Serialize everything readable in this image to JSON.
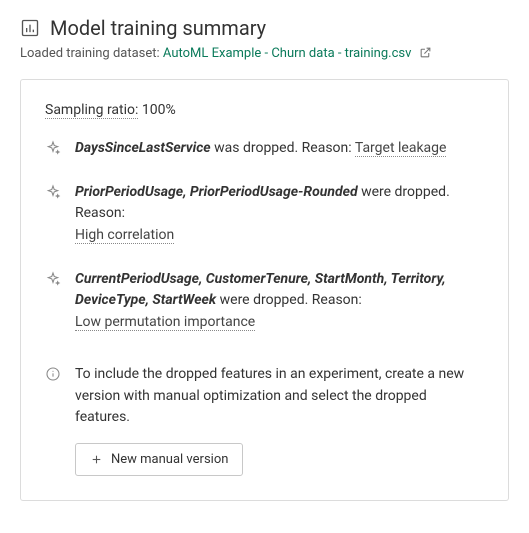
{
  "header": {
    "title": "Model training summary",
    "loaded_label": "Loaded training dataset:",
    "dataset_name": "AutoML Example - Churn data - training.csv"
  },
  "sampling": {
    "label": "Sampling ratio:",
    "value": "100%"
  },
  "drops": [
    {
      "features": "DaysSinceLastService",
      "verb": "was dropped. Reason:",
      "reason": "Target leakage",
      "reason_inline": true
    },
    {
      "features": "PriorPeriodUsage, PriorPeriodUsage-Rounded",
      "verb": "were dropped. Reason:",
      "reason": "High correlation",
      "reason_inline": false
    },
    {
      "features": "CurrentPeriodUsage, CustomerTenure, StartMonth, Territory, DeviceType, StartWeek",
      "verb": "were dropped. Reason:",
      "reason": "Low permutation importance",
      "reason_inline": false
    }
  ],
  "info": {
    "text": "To include the dropped features in an experiment, create a new version with manual optimization and select the dropped features.",
    "button_label": "New manual version"
  }
}
